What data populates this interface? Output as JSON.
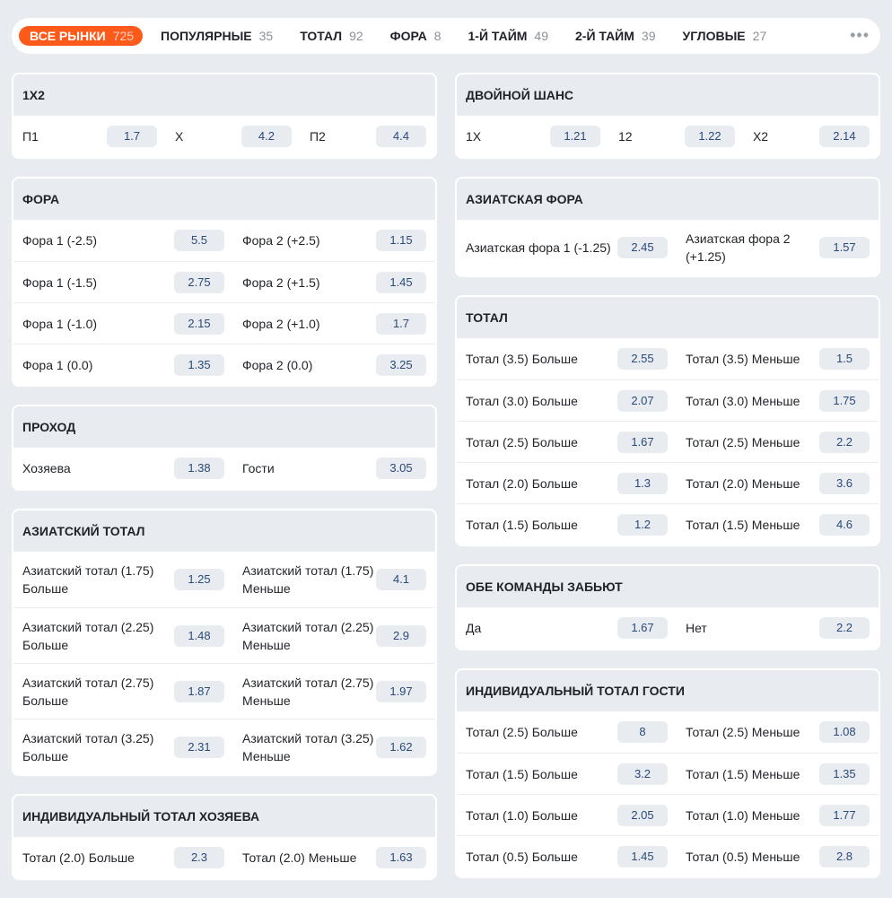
{
  "tabs": [
    {
      "label": "ВСЕ РЫНКИ",
      "count": "725",
      "active": true
    },
    {
      "label": "ПОПУЛЯРНЫЕ",
      "count": "35"
    },
    {
      "label": "ТОТАЛ",
      "count": "92"
    },
    {
      "label": "ФОРА",
      "count": "8"
    },
    {
      "label": "1-Й ТАЙМ",
      "count": "49"
    },
    {
      "label": "2-Й ТАЙМ",
      "count": "39"
    },
    {
      "label": "УГЛОВЫЕ",
      "count": "27"
    }
  ],
  "more_label": "•••",
  "left_markets": [
    {
      "title": "1X2",
      "three": true,
      "rows": [
        [
          {
            "label": "П1",
            "odd": "1.7"
          },
          {
            "label": "X",
            "odd": "4.2"
          },
          {
            "label": "П2",
            "odd": "4.4"
          }
        ]
      ]
    },
    {
      "title": "ФОРА",
      "rows": [
        [
          {
            "label": "Фора 1 (-2.5)",
            "odd": "5.5"
          },
          {
            "label": "Фора 2 (+2.5)",
            "odd": "1.15"
          }
        ],
        [
          {
            "label": "Фора 1 (-1.5)",
            "odd": "2.75"
          },
          {
            "label": "Фора 2 (+1.5)",
            "odd": "1.45"
          }
        ],
        [
          {
            "label": "Фора 1 (-1.0)",
            "odd": "2.15"
          },
          {
            "label": "Фора 2 (+1.0)",
            "odd": "1.7"
          }
        ],
        [
          {
            "label": "Фора 1 (0.0)",
            "odd": "1.35"
          },
          {
            "label": "Фора 2 (0.0)",
            "odd": "3.25"
          }
        ]
      ]
    },
    {
      "title": "ПРОХОД",
      "rows": [
        [
          {
            "label": "Хозяева",
            "odd": "1.38"
          },
          {
            "label": "Гости",
            "odd": "3.05"
          }
        ]
      ]
    },
    {
      "title": "АЗИАТСКИЙ ТОТАЛ",
      "tall": true,
      "rows": [
        [
          {
            "label": "Азиатский тотал (1.75) Больше",
            "odd": "1.25"
          },
          {
            "label": "Азиатский тотал (1.75) Меньше",
            "odd": "4.1"
          }
        ],
        [
          {
            "label": "Азиатский тотал (2.25) Больше",
            "odd": "1.48"
          },
          {
            "label": "Азиатский тотал (2.25) Меньше",
            "odd": "2.9"
          }
        ],
        [
          {
            "label": "Азиатский тотал (2.75) Больше",
            "odd": "1.87"
          },
          {
            "label": "Азиатский тотал (2.75) Меньше",
            "odd": "1.97"
          }
        ],
        [
          {
            "label": "Азиатский тотал (3.25) Больше",
            "odd": "2.31"
          },
          {
            "label": "Азиатский тотал (3.25) Меньше",
            "odd": "1.62"
          }
        ]
      ]
    },
    {
      "title": "ИНДИВИДУАЛЬНЫЙ ТОТАЛ ХОЗЯЕВА",
      "rows": [
        [
          {
            "label": "Тотал (2.0) Больше",
            "odd": "2.3"
          },
          {
            "label": "Тотал (2.0) Меньше",
            "odd": "1.63"
          }
        ]
      ]
    }
  ],
  "right_markets": [
    {
      "title": "ДВОЙНОЙ ШАНС",
      "three": true,
      "rows": [
        [
          {
            "label": "1X",
            "odd": "1.21"
          },
          {
            "label": "12",
            "odd": "1.22"
          },
          {
            "label": "X2",
            "odd": "2.14"
          }
        ]
      ]
    },
    {
      "title": "АЗИАТСКАЯ ФОРА",
      "tall": true,
      "rows": [
        [
          {
            "label": "Азиатская фора 1 (-1.25)",
            "odd": "2.45"
          },
          {
            "label": "Азиатская фора 2 (+1.25)",
            "odd": "1.57"
          }
        ]
      ]
    },
    {
      "title": "ТОТАЛ",
      "rows": [
        [
          {
            "label": "Тотал (3.5) Больше",
            "odd": "2.55"
          },
          {
            "label": "Тотал (3.5) Меньше",
            "odd": "1.5"
          }
        ],
        [
          {
            "label": "Тотал (3.0) Больше",
            "odd": "2.07"
          },
          {
            "label": "Тотал (3.0) Меньше",
            "odd": "1.75"
          }
        ],
        [
          {
            "label": "Тотал (2.5) Больше",
            "odd": "1.67"
          },
          {
            "label": "Тотал (2.5) Меньше",
            "odd": "2.2"
          }
        ],
        [
          {
            "label": "Тотал (2.0) Больше",
            "odd": "1.3"
          },
          {
            "label": "Тотал (2.0) Меньше",
            "odd": "3.6"
          }
        ],
        [
          {
            "label": "Тотал (1.5) Больше",
            "odd": "1.2"
          },
          {
            "label": "Тотал (1.5) Меньше",
            "odd": "4.6"
          }
        ]
      ]
    },
    {
      "title": "ОБЕ КОМАНДЫ ЗАБЬЮТ",
      "rows": [
        [
          {
            "label": "Да",
            "odd": "1.67"
          },
          {
            "label": "Нет",
            "odd": "2.2"
          }
        ]
      ]
    },
    {
      "title": "ИНДИВИДУАЛЬНЫЙ ТОТАЛ ГОСТИ",
      "rows": [
        [
          {
            "label": "Тотал (2.5) Больше",
            "odd": "8"
          },
          {
            "label": "Тотал (2.5) Меньше",
            "odd": "1.08"
          }
        ],
        [
          {
            "label": "Тотал (1.5) Больше",
            "odd": "3.2"
          },
          {
            "label": "Тотал (1.5) Меньше",
            "odd": "1.35"
          }
        ],
        [
          {
            "label": "Тотал (1.0) Больше",
            "odd": "2.05"
          },
          {
            "label": "Тотал (1.0) Меньше",
            "odd": "1.77"
          }
        ],
        [
          {
            "label": "Тотал (0.5) Больше",
            "odd": "1.45"
          },
          {
            "label": "Тотал (0.5) Меньше",
            "odd": "2.8"
          }
        ]
      ]
    }
  ]
}
